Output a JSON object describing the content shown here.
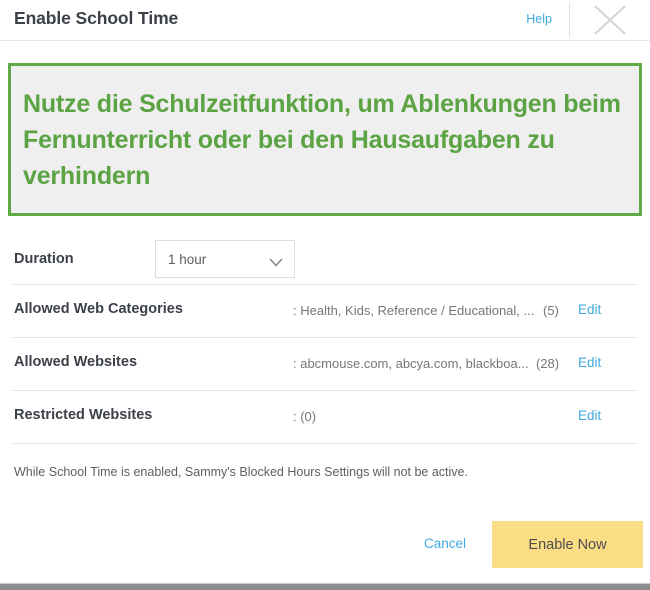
{
  "header": {
    "title": "Enable School Time",
    "help_label": "Help",
    "close_icon": "close-icon"
  },
  "banner": {
    "text": "Nutze die Schulzeitfunktion, um Ablenkungen beim Fernunterricht oder bei den Hausaufgaben zu verhindern",
    "border_color": "#5faa47",
    "text_color": "#5ba343",
    "background_color": "#efefef"
  },
  "settings": {
    "duration": {
      "label": "Duration",
      "selected": "1 hour",
      "chevron_icon": "chevron-down-icon"
    },
    "rows": [
      {
        "label": "Allowed Web Categories",
        "value": ": Health, Kids, Reference / Educational, ...",
        "count": "(5)",
        "edit_label": "Edit"
      },
      {
        "label": "Allowed Websites",
        "value": ": abcmouse.com, abcya.com, blackboa...",
        "count": "(28)",
        "edit_label": "Edit"
      },
      {
        "label": "Restricted Websites",
        "value": ": (0)",
        "count": "",
        "edit_label": "Edit"
      }
    ]
  },
  "note": "While School Time is enabled, Sammy's Blocked Hours Settings will not be active.",
  "footer": {
    "cancel_label": "Cancel",
    "primary_label": "Enable Now",
    "primary_color": "#fbdd85",
    "link_color": "#41a9e0"
  }
}
